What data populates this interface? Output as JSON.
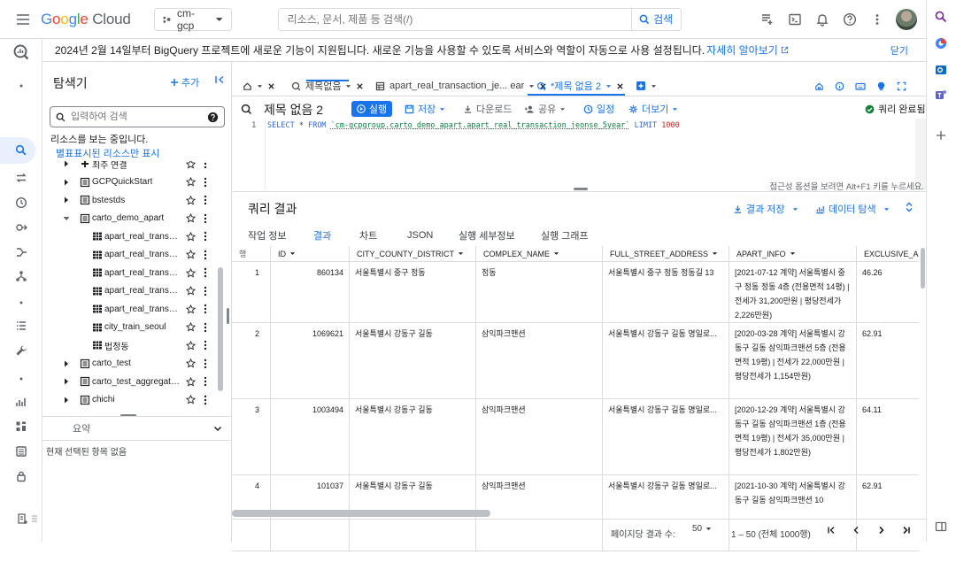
{
  "topbar": {
    "brand": {
      "g": "G",
      "o1": "o",
      "o2": "o",
      "g2": "g",
      "l": "l",
      "e": "e",
      "cloud": "Cloud"
    },
    "project": "cm-gcp",
    "search_placeholder": "리소스, 문서, 제품 등 검색(/)",
    "search_button": "검색"
  },
  "banner": {
    "text": "2024년 2월 14일부터 BigQuery 프로젝트에 새로운 기능이 지원됩니다. 새로운 기능을 사용할 수 있도록 서비스와 역할이 자동으로 사용 설정됩니다.",
    "link": "자세히 알아보기",
    "close": "닫기"
  },
  "explorer": {
    "title": "탐색기",
    "add": "추가",
    "search_placeholder": "입력하여 검색",
    "info": "리소스를 보는 중입니다.",
    "starred_link": "별표표시된 리소스만 표시",
    "tree": [
      {
        "label": "최주 연결",
        "level": 1,
        "kind": "conn"
      },
      {
        "label": "GCPQuickStart",
        "level": 1,
        "kind": "dataset"
      },
      {
        "label": "bstestds",
        "level": 1,
        "kind": "dataset"
      },
      {
        "label": "carto_demo_apart",
        "level": 1,
        "kind": "dataset",
        "open": true
      },
      {
        "label": "apart_real_transactio...",
        "level": 2,
        "kind": "table"
      },
      {
        "label": "apart_real_transactio...",
        "level": 2,
        "kind": "table"
      },
      {
        "label": "apart_real_transactio...",
        "level": 2,
        "kind": "table"
      },
      {
        "label": "apart_real_transactio...",
        "level": 2,
        "kind": "table"
      },
      {
        "label": "apart_real_transactio...",
        "level": 2,
        "kind": "table"
      },
      {
        "label": "city_train_seoul",
        "level": 2,
        "kind": "table"
      },
      {
        "label": "법정동",
        "level": 2,
        "kind": "table"
      },
      {
        "label": "carto_test",
        "level": 1,
        "kind": "dataset"
      },
      {
        "label": "carto_test_aggregation",
        "level": 1,
        "kind": "dataset"
      },
      {
        "label": "chichi",
        "level": 1,
        "kind": "dataset"
      }
    ],
    "summary_title": "요약",
    "summary_empty": "현재 선택된 항목 없음"
  },
  "tabs": [
    {
      "label": "제목없음"
    },
    {
      "label": "apart_real_transaction_je... ear"
    },
    {
      "label": "*제목 없음 2",
      "active": true
    }
  ],
  "toolbar": {
    "title": "제목 없음 2",
    "run": "실행",
    "save": "저장",
    "download": "다운로드",
    "share": "공유",
    "schedule": "일정",
    "more": "더보기",
    "status": "쿼리 완료됨"
  },
  "editor": {
    "line_no": "1",
    "select": "SELECT",
    "star": " * ",
    "from": "FROM",
    "table": "`cm-gcpgroup.carto_demo_apart.apart_real_transaction_jeonse_5year`",
    "limit": "LIMIT",
    "limit_value": "1000",
    "hint": "접근성 옵션을 보려면 Alt+F1 키를 누르세요."
  },
  "results": {
    "title": "쿼리 결과",
    "save_results": "결과 저장",
    "explore_data": "데이터 탐색",
    "tabs": [
      "작업 정보",
      "결과",
      "차트",
      "JSON",
      "실행 세부정보",
      "실행 그래프"
    ],
    "active_tab": "결과",
    "columns": [
      "행",
      "ID",
      "CITY_COUNTY_DISTRICT",
      "COMPLEX_NAME",
      "FULL_STREET_ADDRESS",
      "APART_INFO",
      "EXCLUSIVE_AR"
    ],
    "rows": [
      {
        "row": "1",
        "id": "860134",
        "district": "서울특별시 중구 정동",
        "complex": "정동",
        "address": "서울특별시 중구 정동 정동길 13",
        "info": "[2021-07-12 계약] 서울특별시 중구 정동 정동 4층 (전용면적 14평) | 전세가 31,200만원 | 평당전세가 2,226만원)",
        "area": "46.26"
      },
      {
        "row": "2",
        "id": "1069621",
        "district": "서울특별시 강동구 길동",
        "complex": "삼익파크맨션",
        "address": "서울특별시 강동구 길동 명일로...",
        "info": "[2020-03-28 계약] 서울특별시 강동구 길동 삼익파크맨션 5층 (전용면적 19평) | 전세가 22,000만원 | 평당전세가 1,154만원)",
        "area": "62.91"
      },
      {
        "row": "3",
        "id": "1003494",
        "district": "서울특별시 강동구 길동",
        "complex": "삼익파크맨션",
        "address": "서울특별시 강동구 길동 명일로...",
        "info": "[2020-12-29 계약] 서울특별시 강동구 길동 삼익파크맨션 1층 (전용면적 19평) | 전세가 35,000만원 | 평당전세가 1,802만원)",
        "area": "64.11"
      },
      {
        "row": "4",
        "id": "101037",
        "district": "서울특별시 강동구 길동",
        "complex": "삼익파크맨션",
        "address": "서울특별시 강동구 길동 명일로...",
        "info": "[2021-10-30 계약] 서울특별시 강동구 길동 삼익파크맨션 10",
        "area": "62.91"
      }
    ]
  },
  "pager": {
    "label": "페이지당 결과 수:",
    "per_page": "50",
    "range": "1 – 50 (전체 1000행)"
  }
}
